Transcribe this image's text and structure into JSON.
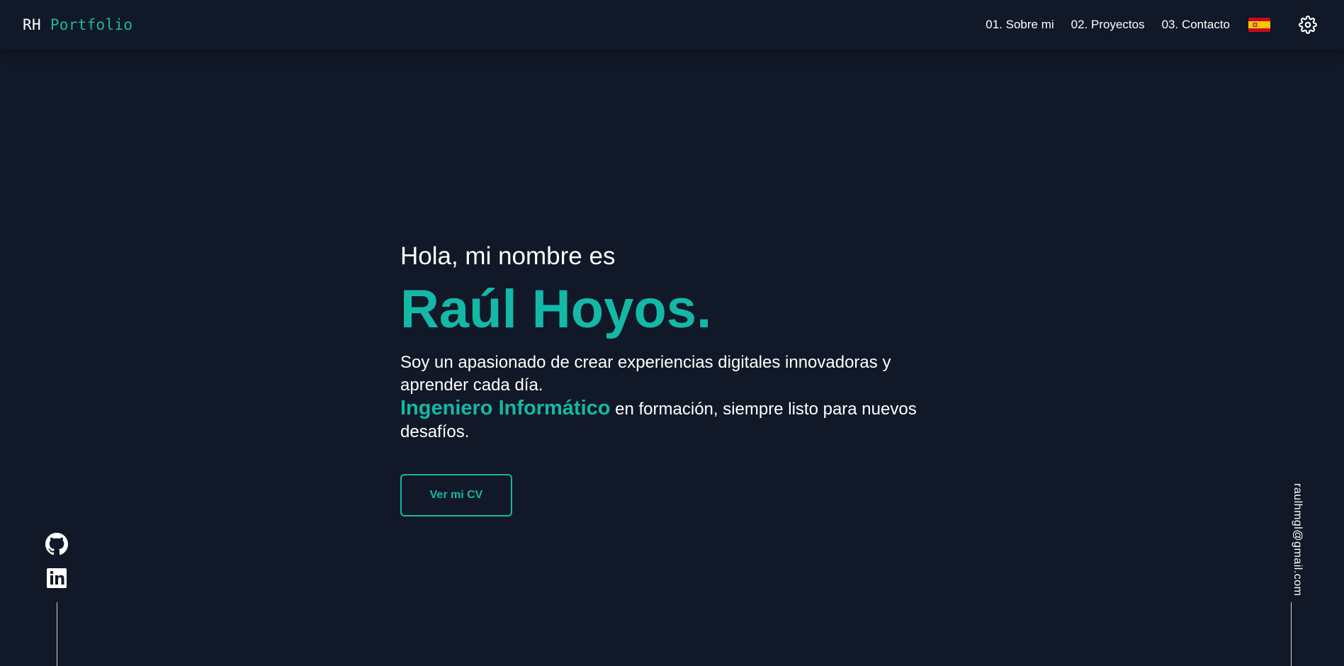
{
  "header": {
    "logo_initials": "RH",
    "logo_text": "Portfolio",
    "nav": [
      {
        "label": "01. Sobre mi"
      },
      {
        "label": "02. Proyectos"
      },
      {
        "label": "03. Contacto"
      }
    ],
    "language_icon": "spain-flag-icon",
    "settings_icon": "gear-icon"
  },
  "hero": {
    "greeting": "Hola, mi nombre es",
    "name": "Raúl Hoyos.",
    "description_line1": "Soy un apasionado de crear experiencias digitales innovadoras y aprender cada día.",
    "highlight": "Ingeniero Informático",
    "description_line2": " en formación, siempre listo para nuevos desafíos.",
    "cv_button": "Ver mi CV"
  },
  "social": {
    "icons": [
      "github-icon",
      "linkedin-icon"
    ]
  },
  "email": "raulhmgl@gmail.com",
  "colors": {
    "background": "#111827",
    "accent": "#14b8a6",
    "text": "#ffffff"
  }
}
